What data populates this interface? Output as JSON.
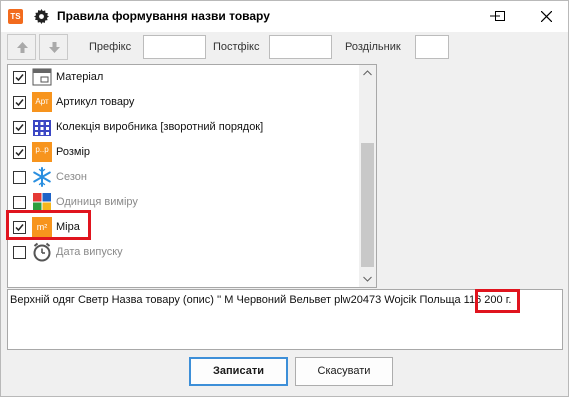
{
  "window": {
    "app_logo": "TS",
    "title": "Правила формування назви товару"
  },
  "toolbar": {
    "prefix_label": "Префікс",
    "prefix_value": "",
    "postfix_label": "Постфікс",
    "postfix_value": "",
    "separator_label": "Роздільник",
    "separator_value": ""
  },
  "list": {
    "items": [
      {
        "label": "Матеріал",
        "checked": true,
        "icon": "material-icon"
      },
      {
        "label": "Артикул товару",
        "checked": true,
        "icon": "article-icon",
        "icon_text": "Арт"
      },
      {
        "label": "Колекція виробника [зворотний порядок]",
        "checked": true,
        "icon": "collection-icon"
      },
      {
        "label": "Розмір",
        "checked": true,
        "icon": "size-icon",
        "icon_text": "р..р"
      },
      {
        "label": "Сезон",
        "checked": false,
        "icon": "snowflake-icon"
      },
      {
        "label": "Одиниця виміру",
        "checked": false,
        "icon": "units-icon"
      },
      {
        "label": "Міра",
        "checked": true,
        "icon": "measure-icon",
        "icon_text": "m²"
      },
      {
        "label": "Дата випуску",
        "checked": false,
        "icon": "clock-icon"
      }
    ]
  },
  "preview": {
    "text_main": "Верхній одяг Светр Назва товару (опис) '' М Червоний Вельвет plw20473 Wojcik Польща 116",
    "text_highlight": "200 г."
  },
  "buttons": {
    "save": "Записати",
    "cancel": "Скасувати"
  },
  "colors": {
    "highlight": "#e0141e",
    "accent": "#f7941d",
    "primary_border": "#3d8fd8"
  }
}
